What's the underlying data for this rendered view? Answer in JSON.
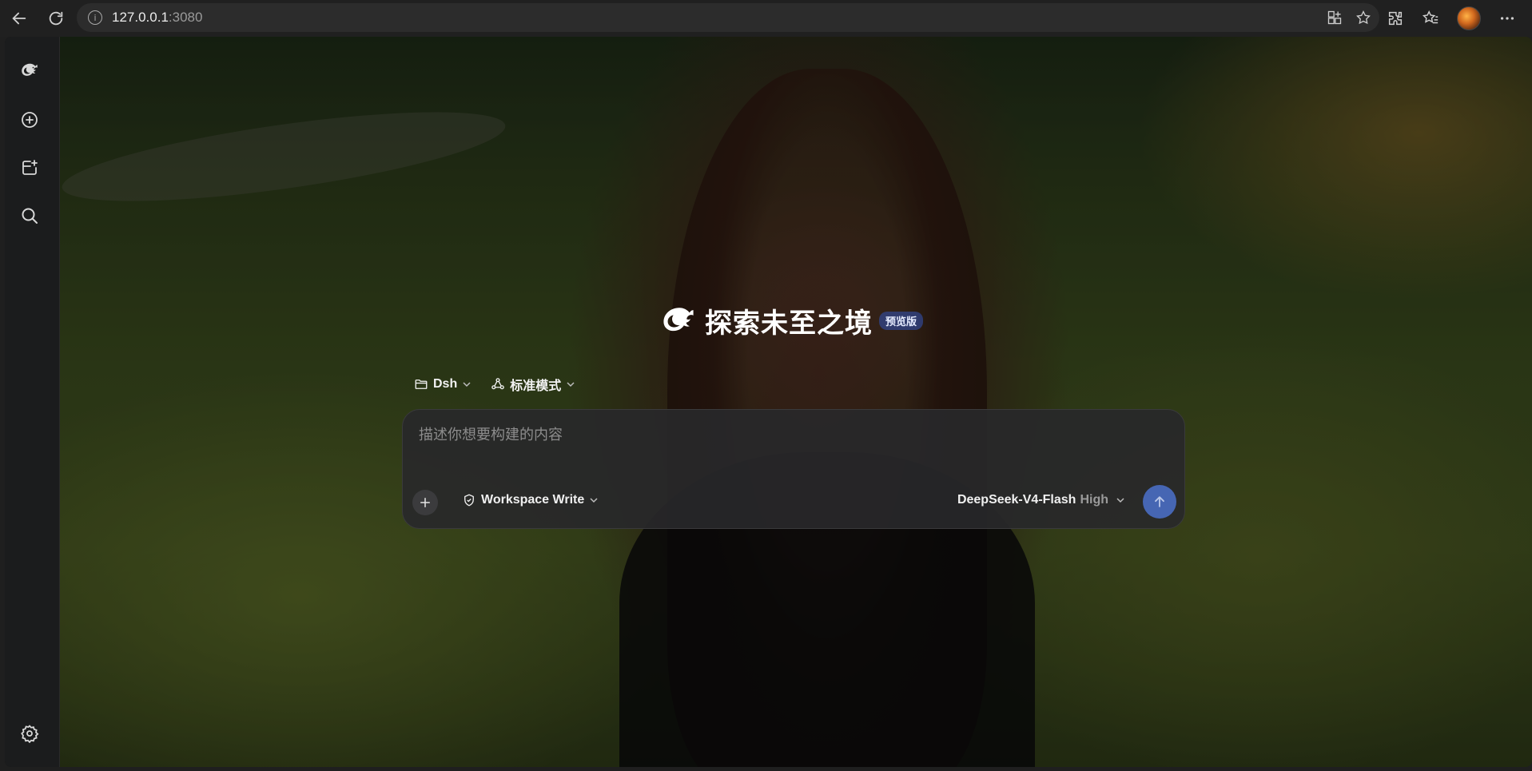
{
  "browser": {
    "url_host": "127.0.0.1",
    "url_port": ":3080",
    "info_icon": "info-icon"
  },
  "sidebar": {
    "items": [
      {
        "icon": "whale-logo-icon"
      },
      {
        "icon": "new-chat-icon"
      },
      {
        "icon": "new-project-icon"
      },
      {
        "icon": "search-icon"
      },
      {
        "icon": "settings-icon"
      }
    ]
  },
  "hero": {
    "title": "探索未至之境",
    "badge": "预览版"
  },
  "chips": {
    "folder_label": "Dsh",
    "mode_label": "标准模式"
  },
  "composer": {
    "placeholder": "描述你想要构建的内容",
    "value": "",
    "permission_label": "Workspace Write",
    "model_name": "DeepSeek-V4-Flash",
    "model_level": "High"
  },
  "colors": {
    "accent": "#4666b3",
    "badge_bg": "#32468c"
  }
}
